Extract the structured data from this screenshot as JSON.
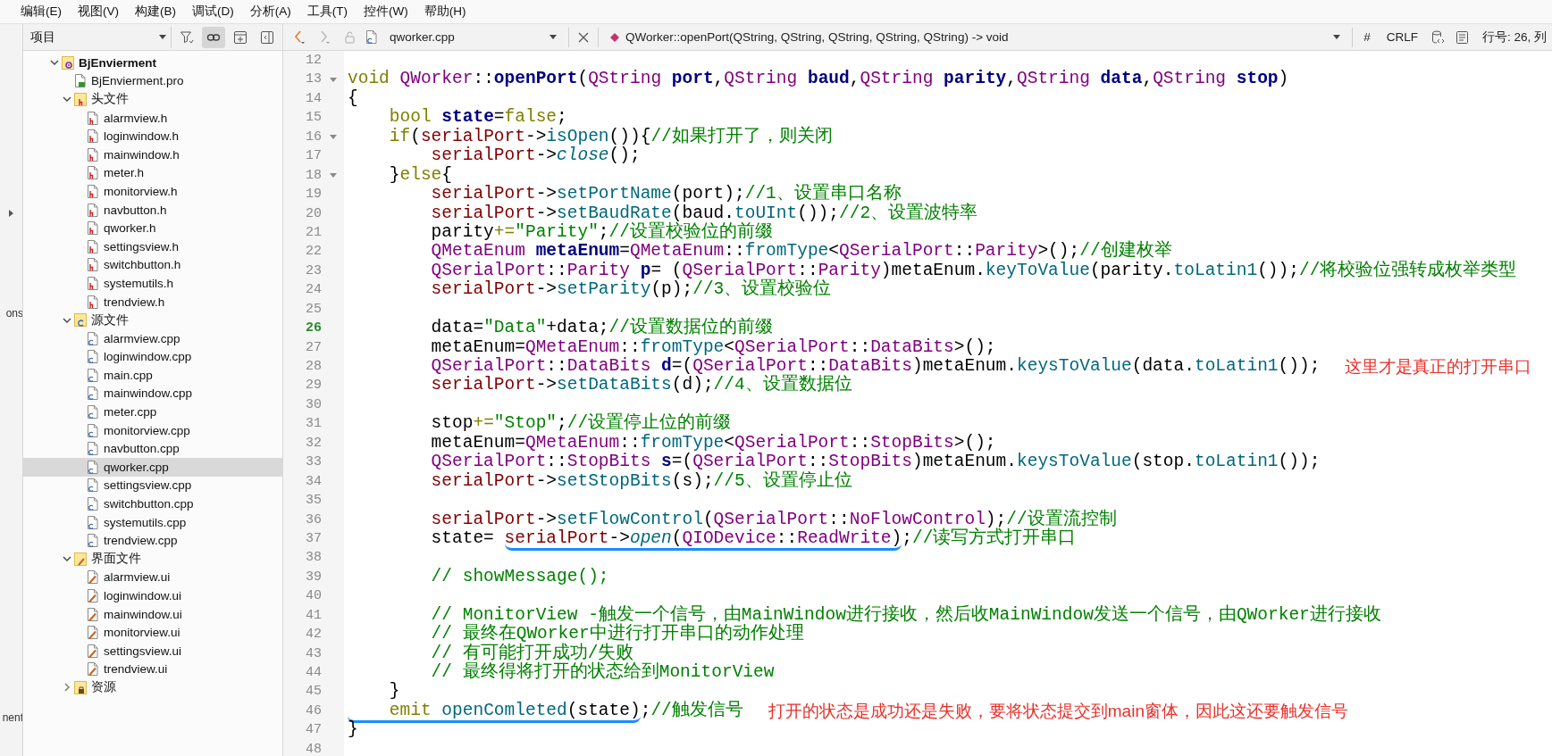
{
  "menu_bar": [
    "编辑(E)",
    "视图(V)",
    "构建(B)",
    "调试(D)",
    "分析(A)",
    "工具(T)",
    "控件(W)",
    "帮助(H)"
  ],
  "left_pane": {
    "label_1": "ons",
    "label_2": "nent"
  },
  "sidebar": {
    "title": "项目",
    "sync_on": true,
    "tree": [
      {
        "label": "BjEnvierment",
        "kind": "project",
        "expanded": true,
        "selected": false,
        "children": [
          {
            "label": "BjEnvierment.pro",
            "kind": "pro",
            "selected": false
          },
          {
            "label": "头文件",
            "kind": "h-folder",
            "expanded": true,
            "selected": false,
            "children": [
              {
                "label": "alarmview.h",
                "kind": "h",
                "selected": false
              },
              {
                "label": "loginwindow.h",
                "kind": "h",
                "selected": false
              },
              {
                "label": "mainwindow.h",
                "kind": "h",
                "selected": false
              },
              {
                "label": "meter.h",
                "kind": "h",
                "selected": false
              },
              {
                "label": "monitorview.h",
                "kind": "h",
                "selected": false
              },
              {
                "label": "navbutton.h",
                "kind": "h",
                "selected": false
              },
              {
                "label": "qworker.h",
                "kind": "h",
                "selected": false
              },
              {
                "label": "settingsview.h",
                "kind": "h",
                "selected": false
              },
              {
                "label": "switchbutton.h",
                "kind": "h",
                "selected": false
              },
              {
                "label": "systemutils.h",
                "kind": "h",
                "selected": false
              },
              {
                "label": "trendview.h",
                "kind": "h",
                "selected": false
              }
            ]
          },
          {
            "label": "源文件",
            "kind": "cpp-folder",
            "expanded": true,
            "selected": false,
            "children": [
              {
                "label": "alarmview.cpp",
                "kind": "cpp",
                "selected": false
              },
              {
                "label": "loginwindow.cpp",
                "kind": "cpp",
                "selected": false
              },
              {
                "label": "main.cpp",
                "kind": "cpp",
                "selected": false
              },
              {
                "label": "mainwindow.cpp",
                "kind": "cpp",
                "selected": false
              },
              {
                "label": "meter.cpp",
                "kind": "cpp",
                "selected": false
              },
              {
                "label": "monitorview.cpp",
                "kind": "cpp",
                "selected": false
              },
              {
                "label": "navbutton.cpp",
                "kind": "cpp",
                "selected": false
              },
              {
                "label": "qworker.cpp",
                "kind": "cpp",
                "selected": true
              },
              {
                "label": "settingsview.cpp",
                "kind": "cpp",
                "selected": false
              },
              {
                "label": "switchbutton.cpp",
                "kind": "cpp",
                "selected": false
              },
              {
                "label": "systemutils.cpp",
                "kind": "cpp",
                "selected": false
              },
              {
                "label": "trendview.cpp",
                "kind": "cpp",
                "selected": false
              }
            ]
          },
          {
            "label": "界面文件",
            "kind": "ui-folder",
            "expanded": true,
            "selected": false,
            "children": [
              {
                "label": "alarmview.ui",
                "kind": "ui",
                "selected": false
              },
              {
                "label": "loginwindow.ui",
                "kind": "ui",
                "selected": false
              },
              {
                "label": "mainwindow.ui",
                "kind": "ui",
                "selected": false
              },
              {
                "label": "monitorview.ui",
                "kind": "ui",
                "selected": false
              },
              {
                "label": "settingsview.ui",
                "kind": "ui",
                "selected": false
              },
              {
                "label": "trendview.ui",
                "kind": "ui",
                "selected": false
              }
            ]
          },
          {
            "label": "资源",
            "kind": "res-folder",
            "expanded": false,
            "selected": false
          }
        ]
      }
    ]
  },
  "editor": {
    "toolbar": {
      "back_enabled": true,
      "forward_enabled": false,
      "file": "qworker.cpp",
      "symbol": "QWorker::openPort(QString, QString, QString, QString, QString) -> void",
      "indentation": "#",
      "line_ending": "CRLF",
      "position": "行号: 26, 列"
    },
    "lines": [
      {
        "number": "12",
        "foldable": false,
        "current": false
      },
      {
        "number": "13",
        "foldable": true,
        "current": false,
        "tokens": [
          {
            "kind": "keyword",
            "text": "void "
          },
          {
            "kind": "type",
            "text": "QWorker"
          },
          {
            "kind": "plain",
            "text": "::"
          },
          {
            "kind": "decl",
            "text": "openPort"
          },
          {
            "kind": "plain",
            "text": "("
          },
          {
            "kind": "type",
            "text": "QString"
          },
          {
            "kind": "decl",
            "text": " port"
          },
          {
            "kind": "plain",
            "text": ","
          },
          {
            "kind": "type",
            "text": "QString"
          },
          {
            "kind": "decl",
            "text": " baud"
          },
          {
            "kind": "plain",
            "text": ","
          },
          {
            "kind": "type",
            "text": "QString"
          },
          {
            "kind": "decl",
            "text": " parity"
          },
          {
            "kind": "plain",
            "text": ","
          },
          {
            "kind": "type",
            "text": "QString"
          },
          {
            "kind": "decl",
            "text": " data"
          },
          {
            "kind": "plain",
            "text": ","
          },
          {
            "kind": "type",
            "text": "QString"
          },
          {
            "kind": "decl",
            "text": " stop"
          },
          {
            "kind": "plain",
            "text": ")"
          }
        ]
      },
      {
        "number": "14",
        "foldable": false,
        "current": false,
        "tokens": [
          {
            "kind": "plain",
            "text": "{"
          }
        ]
      },
      {
        "number": "15",
        "foldable": false,
        "current": false,
        "tokens": [
          {
            "kind": "keyword",
            "text": "    bool "
          },
          {
            "kind": "decl",
            "text": "state"
          },
          {
            "kind": "plain",
            "text": "="
          },
          {
            "kind": "keyword",
            "text": "false"
          },
          {
            "kind": "plain",
            "text": ";"
          }
        ]
      },
      {
        "number": "16",
        "foldable": true,
        "current": false,
        "tokens": [
          {
            "kind": "keyword",
            "text": "    if"
          },
          {
            "kind": "plain",
            "text": "("
          },
          {
            "kind": "member",
            "text": "serialPort"
          },
          {
            "kind": "plain",
            "text": "->"
          },
          {
            "kind": "function",
            "text": "isOpen"
          },
          {
            "kind": "plain",
            "text": "()){"
          },
          {
            "kind": "comment",
            "text": "//如果打开了，则关闭"
          }
        ]
      },
      {
        "number": "17",
        "foldable": false,
        "current": false,
        "tokens": [
          {
            "kind": "member",
            "text": "        serialPort"
          },
          {
            "kind": "plain",
            "text": "->"
          },
          {
            "kind": "virtual",
            "text": "close"
          },
          {
            "kind": "plain",
            "text": "();"
          }
        ]
      },
      {
        "number": "18",
        "foldable": true,
        "current": false,
        "tokens": [
          {
            "kind": "plain",
            "text": "    }"
          },
          {
            "kind": "keyword",
            "text": "else"
          },
          {
            "kind": "plain",
            "text": "{"
          }
        ]
      },
      {
        "number": "19",
        "foldable": false,
        "current": false,
        "tokens": [
          {
            "kind": "member",
            "text": "        serialPort"
          },
          {
            "kind": "plain",
            "text": "->"
          },
          {
            "kind": "function",
            "text": "setPortName"
          },
          {
            "kind": "plain",
            "text": "(port);"
          },
          {
            "kind": "comment",
            "text": "//1、设置串口名称"
          }
        ]
      },
      {
        "number": "20",
        "foldable": false,
        "current": false,
        "tokens": [
          {
            "kind": "member",
            "text": "        serialPort"
          },
          {
            "kind": "plain",
            "text": "->"
          },
          {
            "kind": "function",
            "text": "setBaudRate"
          },
          {
            "kind": "plain",
            "text": "(baud."
          },
          {
            "kind": "function",
            "text": "toUInt"
          },
          {
            "kind": "plain",
            "text": "());"
          },
          {
            "kind": "comment",
            "text": "//2、设置波特率"
          }
        ]
      },
      {
        "number": "21",
        "foldable": false,
        "current": false,
        "tokens": [
          {
            "kind": "plain",
            "text": "        parity"
          },
          {
            "kind": "keyword",
            "text": "+="
          },
          {
            "kind": "string",
            "text": "\"Parity\""
          },
          {
            "kind": "plain",
            "text": ";"
          },
          {
            "kind": "comment",
            "text": "//设置校验位的前缀"
          }
        ]
      },
      {
        "number": "22",
        "foldable": false,
        "current": false,
        "tokens": [
          {
            "kind": "type",
            "text": "        QMetaEnum "
          },
          {
            "kind": "decl",
            "text": "metaEnum"
          },
          {
            "kind": "plain",
            "text": "="
          },
          {
            "kind": "type",
            "text": "QMetaEnum"
          },
          {
            "kind": "plain",
            "text": "::"
          },
          {
            "kind": "function",
            "text": "fromType"
          },
          {
            "kind": "plain",
            "text": "<"
          },
          {
            "kind": "type",
            "text": "QSerialPort"
          },
          {
            "kind": "plain",
            "text": "::"
          },
          {
            "kind": "type",
            "text": "Parity"
          },
          {
            "kind": "plain",
            "text": ">();"
          },
          {
            "kind": "comment",
            "text": "//创建枚举"
          }
        ]
      },
      {
        "number": "23",
        "foldable": false,
        "current": false,
        "tokens": [
          {
            "kind": "type",
            "text": "        QSerialPort"
          },
          {
            "kind": "plain",
            "text": "::"
          },
          {
            "kind": "type",
            "text": "Parity "
          },
          {
            "kind": "decl",
            "text": "p"
          },
          {
            "kind": "plain",
            "text": "= ("
          },
          {
            "kind": "type",
            "text": "QSerialPort"
          },
          {
            "kind": "plain",
            "text": "::"
          },
          {
            "kind": "type",
            "text": "Parity"
          },
          {
            "kind": "plain",
            "text": ")metaEnum."
          },
          {
            "kind": "function",
            "text": "keyToValue"
          },
          {
            "kind": "plain",
            "text": "(parity."
          },
          {
            "kind": "function",
            "text": "toLatin1"
          },
          {
            "kind": "plain",
            "text": "());"
          },
          {
            "kind": "comment",
            "text": "//将校验位强转成枚举类型"
          }
        ]
      },
      {
        "number": "24",
        "foldable": false,
        "current": false,
        "tokens": [
          {
            "kind": "member",
            "text": "        serialPort"
          },
          {
            "kind": "plain",
            "text": "->"
          },
          {
            "kind": "function",
            "text": "setParity"
          },
          {
            "kind": "plain",
            "text": "(p);"
          },
          {
            "kind": "comment",
            "text": "//3、设置校验位"
          }
        ]
      },
      {
        "number": "25",
        "foldable": false,
        "current": false
      },
      {
        "number": "26",
        "foldable": false,
        "current": true,
        "tokens": [
          {
            "kind": "plain",
            "text": "        data="
          },
          {
            "kind": "string",
            "text": "\"Data\""
          },
          {
            "kind": "plain",
            "text": "+data;"
          },
          {
            "kind": "comment",
            "text": "//设置数据位的前缀"
          }
        ]
      },
      {
        "number": "27",
        "foldable": false,
        "current": false,
        "tokens": [
          {
            "kind": "plain",
            "text": "        metaEnum="
          },
          {
            "kind": "type",
            "text": "QMetaEnum"
          },
          {
            "kind": "plain",
            "text": "::"
          },
          {
            "kind": "function",
            "text": "fromType"
          },
          {
            "kind": "plain",
            "text": "<"
          },
          {
            "kind": "type",
            "text": "QSerialPort"
          },
          {
            "kind": "plain",
            "text": "::"
          },
          {
            "kind": "type",
            "text": "DataBits"
          },
          {
            "kind": "plain",
            "text": ">();"
          }
        ]
      },
      {
        "number": "28",
        "foldable": false,
        "current": false,
        "note": "这里才是真正的打开串口",
        "tokens": [
          {
            "kind": "type",
            "text": "        QSerialPort"
          },
          {
            "kind": "plain",
            "text": "::"
          },
          {
            "kind": "type",
            "text": "DataBits "
          },
          {
            "kind": "decl",
            "text": "d"
          },
          {
            "kind": "plain",
            "text": "=("
          },
          {
            "kind": "type",
            "text": "QSerialPort"
          },
          {
            "kind": "plain",
            "text": "::"
          },
          {
            "kind": "type",
            "text": "DataBits"
          },
          {
            "kind": "plain",
            "text": ")metaEnum."
          },
          {
            "kind": "function",
            "text": "keysToValue"
          },
          {
            "kind": "plain",
            "text": "(data."
          },
          {
            "kind": "function",
            "text": "toLatin1"
          },
          {
            "kind": "plain",
            "text": "());"
          }
        ]
      },
      {
        "number": "29",
        "foldable": false,
        "current": false,
        "tokens": [
          {
            "kind": "member",
            "text": "        serialPort"
          },
          {
            "kind": "plain",
            "text": "->"
          },
          {
            "kind": "function",
            "text": "setDataBits"
          },
          {
            "kind": "plain",
            "text": "(d);"
          },
          {
            "kind": "comment",
            "text": "//4、设置数据位"
          }
        ]
      },
      {
        "number": "30",
        "foldable": false,
        "current": false
      },
      {
        "number": "31",
        "foldable": false,
        "current": false,
        "tokens": [
          {
            "kind": "plain",
            "text": "        stop"
          },
          {
            "kind": "keyword",
            "text": "+="
          },
          {
            "kind": "string",
            "text": "\"Stop\""
          },
          {
            "kind": "plain",
            "text": ";"
          },
          {
            "kind": "comment",
            "text": "//设置停止位的前缀"
          }
        ]
      },
      {
        "number": "32",
        "foldable": false,
        "current": false,
        "tokens": [
          {
            "kind": "plain",
            "text": "        metaEnum="
          },
          {
            "kind": "type",
            "text": "QMetaEnum"
          },
          {
            "kind": "plain",
            "text": "::"
          },
          {
            "kind": "function",
            "text": "fromType"
          },
          {
            "kind": "plain",
            "text": "<"
          },
          {
            "kind": "type",
            "text": "QSerialPort"
          },
          {
            "kind": "plain",
            "text": "::"
          },
          {
            "kind": "type",
            "text": "StopBits"
          },
          {
            "kind": "plain",
            "text": ">();"
          }
        ]
      },
      {
        "number": "33",
        "foldable": false,
        "current": false,
        "tokens": [
          {
            "kind": "type",
            "text": "        QSerialPort"
          },
          {
            "kind": "plain",
            "text": "::"
          },
          {
            "kind": "type",
            "text": "StopBits "
          },
          {
            "kind": "decl",
            "text": "s"
          },
          {
            "kind": "plain",
            "text": "=("
          },
          {
            "kind": "type",
            "text": "QSerialPort"
          },
          {
            "kind": "plain",
            "text": "::"
          },
          {
            "kind": "type",
            "text": "StopBits"
          },
          {
            "kind": "plain",
            "text": ")metaEnum."
          },
          {
            "kind": "function",
            "text": "keysToValue"
          },
          {
            "kind": "plain",
            "text": "(stop."
          },
          {
            "kind": "function",
            "text": "toLatin1"
          },
          {
            "kind": "plain",
            "text": "());"
          }
        ]
      },
      {
        "number": "34",
        "foldable": false,
        "current": false,
        "tokens": [
          {
            "kind": "member",
            "text": "        serialPort"
          },
          {
            "kind": "plain",
            "text": "->"
          },
          {
            "kind": "function",
            "text": "setStopBits"
          },
          {
            "kind": "plain",
            "text": "(s);"
          },
          {
            "kind": "comment",
            "text": "//5、设置停止位"
          }
        ]
      },
      {
        "number": "35",
        "foldable": false,
        "current": false
      },
      {
        "number": "36",
        "foldable": false,
        "current": false,
        "tokens": [
          {
            "kind": "member",
            "text": "        serialPort"
          },
          {
            "kind": "plain",
            "text": "->"
          },
          {
            "kind": "function",
            "text": "setFlowControl"
          },
          {
            "kind": "plain",
            "text": "("
          },
          {
            "kind": "type",
            "text": "QSerialPort"
          },
          {
            "kind": "plain",
            "text": "::"
          },
          {
            "kind": "enum",
            "text": "NoFlowControl"
          },
          {
            "kind": "plain",
            "text": ");"
          },
          {
            "kind": "comment",
            "text": "//设置流控制"
          }
        ]
      },
      {
        "number": "37",
        "foldable": false,
        "current": false,
        "tokens": [
          {
            "kind": "plain",
            "text": "        state= "
          },
          {
            "kind": "marked",
            "tokens": [
              {
                "kind": "member",
                "text": "serialPort"
              },
              {
                "kind": "plain",
                "text": "->"
              },
              {
                "kind": "virtual",
                "text": "open"
              },
              {
                "kind": "plain",
                "text": "("
              },
              {
                "kind": "type",
                "text": "QIODevice"
              },
              {
                "kind": "plain",
                "text": "::"
              },
              {
                "kind": "enum",
                "text": "ReadWrite"
              },
              {
                "kind": "plain",
                "text": ")"
              }
            ]
          },
          {
            "kind": "plain",
            "text": ";"
          },
          {
            "kind": "comment",
            "text": "//读写方式打开串口"
          }
        ]
      },
      {
        "number": "38",
        "foldable": false,
        "current": false
      },
      {
        "number": "39",
        "foldable": false,
        "current": false,
        "tokens": [
          {
            "kind": "comment",
            "text": "        // showMessage();"
          }
        ]
      },
      {
        "number": "40",
        "foldable": false,
        "current": false
      },
      {
        "number": "41",
        "foldable": false,
        "current": false,
        "tokens": [
          {
            "kind": "comment",
            "text": "        // MonitorView -触发一个信号，由MainWindow进行接收，然后收MainWindow发送一个信号，由QWorker进行接收"
          }
        ]
      },
      {
        "number": "42",
        "foldable": false,
        "current": false,
        "tokens": [
          {
            "kind": "comment",
            "text": "        // 最终在QWorker中进行打开串口的动作处理"
          }
        ]
      },
      {
        "number": "43",
        "foldable": false,
        "current": false,
        "tokens": [
          {
            "kind": "comment",
            "text": "        // 有可能打开成功/失败"
          }
        ]
      },
      {
        "number": "44",
        "foldable": false,
        "current": false,
        "tokens": [
          {
            "kind": "comment",
            "text": "        // 最终得将打开的状态给到MonitorView"
          }
        ]
      },
      {
        "number": "45",
        "foldable": false,
        "current": false,
        "tokens": [
          {
            "kind": "plain",
            "text": "    }"
          }
        ]
      },
      {
        "number": "46",
        "foldable": false,
        "current": false,
        "note": "打开的状态是成功还是失败，要将状态提交到main窗体，因此这还要触发信号",
        "tokens": [
          {
            "kind": "marked",
            "tokens": [
              {
                "kind": "keyword",
                "text": "    emit "
              },
              {
                "kind": "function",
                "text": "openComleted"
              },
              {
                "kind": "plain",
                "text": "(state)"
              }
            ]
          },
          {
            "kind": "plain",
            "text": ";"
          },
          {
            "kind": "comment",
            "text": "//触发信号"
          }
        ]
      },
      {
        "number": "47",
        "foldable": false,
        "current": false,
        "tokens": [
          {
            "kind": "plain",
            "text": "}"
          }
        ]
      },
      {
        "number": "48",
        "foldable": false,
        "current": false
      }
    ]
  }
}
